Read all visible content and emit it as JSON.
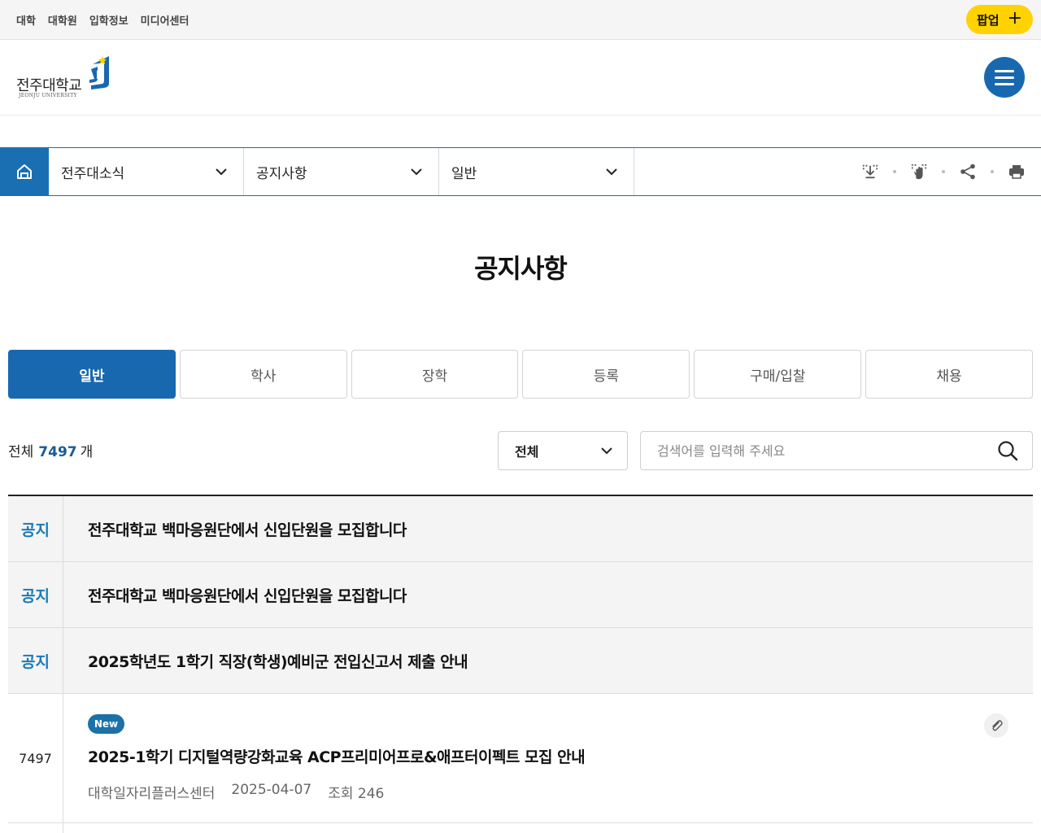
{
  "util_links": [
    "대학",
    "대학원",
    "입학정보",
    "미디어센터"
  ],
  "popup_label": "팝업",
  "popup_plus": "+",
  "logo": {
    "name_ko": "전주대학교",
    "name_en": "JEONJU UNIVERSITY"
  },
  "location": {
    "level1": "전주대소식",
    "level2": "공지사항",
    "level3": "일반"
  },
  "tool_icons": [
    "download-icon",
    "braille-icon",
    "share-icon",
    "print-icon"
  ],
  "page_title": "공지사항",
  "tabs": [
    "일반",
    "학사",
    "장학",
    "등록",
    "구매/입찰",
    "채용"
  ],
  "active_tab": "일반",
  "count": {
    "prefix": "전체",
    "value": "7497",
    "suffix": "개"
  },
  "filter": {
    "selected": "전체"
  },
  "search": {
    "placeholder": "검색어를 입력해 주세요",
    "value": ""
  },
  "notices": [
    {
      "label": "공지",
      "title": "전주대학교 백마응원단에서 신입단원을 모집합니다"
    },
    {
      "label": "공지",
      "title": "전주대학교 백마응원단에서 신입단원을 모집합니다"
    },
    {
      "label": "공지",
      "title": "2025학년도 1학기 직장(학생)예비군 전입신고서 제출 안내"
    }
  ],
  "posts": [
    {
      "num": "7497",
      "badge": "New",
      "title": "2025-1학기 디지털역량강화교육 ACP프리미어프로&애프터이펙트 모집 안내",
      "dept": "대학일자리플러스센터",
      "date": "2025-04-07",
      "views": "조회 246",
      "has_attachment": true
    }
  ],
  "colors": {
    "brand_blue": "#1868b0",
    "popup_yellow": "#ffd200",
    "notice_label": "#1a7ab8",
    "new_badge": "#1b72a8"
  }
}
